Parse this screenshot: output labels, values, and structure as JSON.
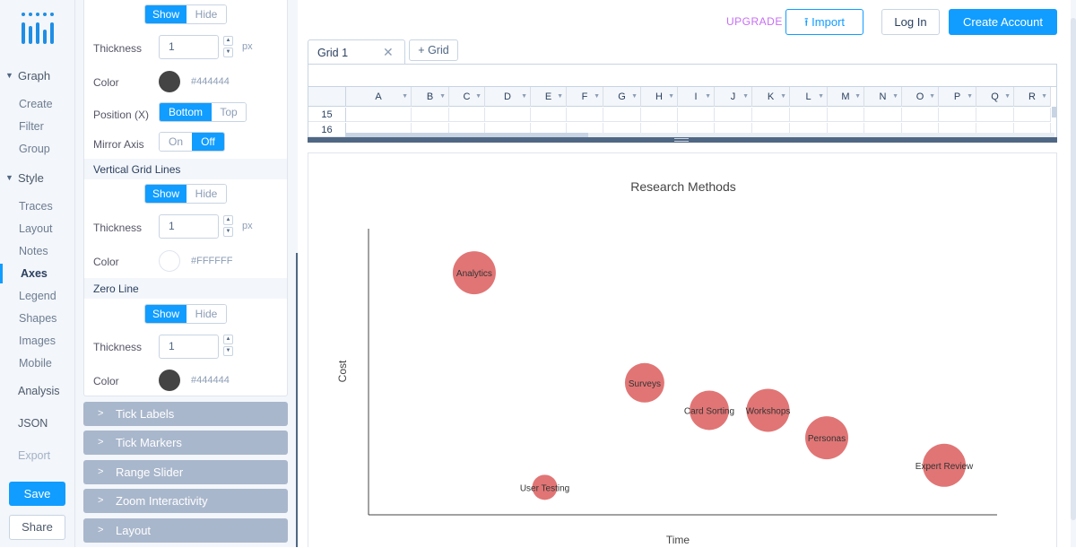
{
  "nav": {
    "sections": [
      {
        "label": "Graph",
        "items": [
          "Create",
          "Filter",
          "Group"
        ]
      },
      {
        "label": "Style",
        "items": [
          "Traces",
          "Layout",
          "Notes",
          "Axes",
          "Legend",
          "Shapes",
          "Images",
          "Mobile"
        ]
      }
    ],
    "active_item": "Axes",
    "extra": [
      "Analysis",
      "JSON",
      "Export"
    ],
    "save_label": "Save",
    "share_label": "Share"
  },
  "panel": {
    "top_toggle": {
      "show": "Show",
      "hide": "Hide",
      "selected": "Show"
    },
    "thickness_label": "Thickness",
    "color_label": "Color",
    "unit": "px",
    "grid_lines": {
      "thickness": "1",
      "color": "#444444"
    },
    "position_label": "Position (X)",
    "position_options": [
      "Bottom",
      "Top"
    ],
    "position_selected": "Bottom",
    "mirror_label": "Mirror Axis",
    "mirror_options": [
      "On",
      "Off"
    ],
    "mirror_selected": "Off",
    "vertical_grid": {
      "title": "Vertical Grid Lines",
      "show": "Show",
      "hide": "Hide",
      "selected": "Show",
      "thickness": "1",
      "color": "#FFFFFF"
    },
    "zero_line": {
      "title": "Zero Line",
      "show": "Show",
      "hide": "Hide",
      "selected": "Show",
      "thickness": "1",
      "color": "#444444"
    },
    "folds": [
      "Tick Labels",
      "Tick Markers",
      "Range Slider",
      "Zoom Interactivity",
      "Layout"
    ]
  },
  "topbar": {
    "upgrade": "UPGRADE",
    "import": "Import",
    "login": "Log In",
    "create_account": "Create Account"
  },
  "grid": {
    "tab_label": "Grid 1",
    "add_label": "Grid",
    "columns": [
      "A",
      "B",
      "C",
      "D",
      "E",
      "F",
      "G",
      "H",
      "I",
      "J",
      "K",
      "L",
      "M",
      "N",
      "O",
      "P",
      "Q",
      "R"
    ],
    "rows": [
      "15",
      "16"
    ]
  },
  "chart_data": {
    "type": "scatter",
    "title": "Research Methods",
    "xlabel": "Time",
    "ylabel": "Cost",
    "grid": false,
    "marker_color": "#e17575",
    "points": [
      {
        "label": "Analytics",
        "x": 1.0,
        "y": 8.8,
        "size": 24
      },
      {
        "label": "User Testing",
        "x": 2.2,
        "y": 1.0,
        "size": 14
      },
      {
        "label": "Surveys",
        "x": 3.9,
        "y": 4.8,
        "size": 22
      },
      {
        "label": "Card Sorting",
        "x": 5.0,
        "y": 3.8,
        "size": 22
      },
      {
        "label": "Workshops",
        "x": 6.0,
        "y": 3.8,
        "size": 24
      },
      {
        "label": "Personas",
        "x": 7.0,
        "y": 2.8,
        "size": 24
      },
      {
        "label": "Expert Review",
        "x": 9.0,
        "y": 1.8,
        "size": 24
      }
    ],
    "xlim": [
      -0.8,
      9.9
    ],
    "ylim": [
      0,
      10.4
    ]
  }
}
